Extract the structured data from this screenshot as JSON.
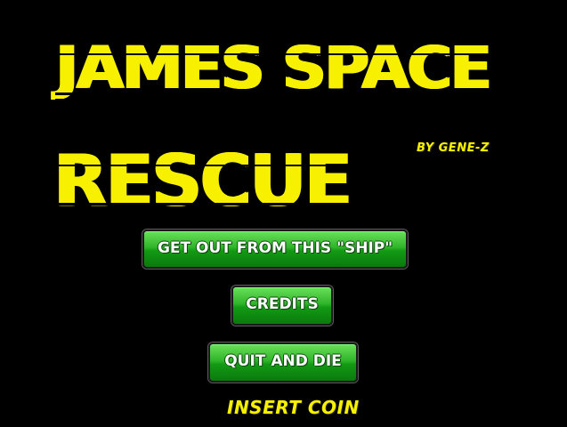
{
  "game": {
    "title_line_1": "JAMES SPACE",
    "title_line_2": "RESCUE",
    "byline": "BY GENE-Z"
  },
  "menu": {
    "buttons": [
      {
        "label": "GET OUT FROM THIS \"SHIP\""
      },
      {
        "label": "CREDITS"
      },
      {
        "label": "QUIT AND DIE"
      }
    ]
  },
  "prompt": {
    "insert_coin": "INSERT COIN"
  },
  "colors": {
    "background": "#000000",
    "title_yellow": "#f7f000",
    "button_green": "#1fa51e",
    "button_text": "#ffffff"
  }
}
